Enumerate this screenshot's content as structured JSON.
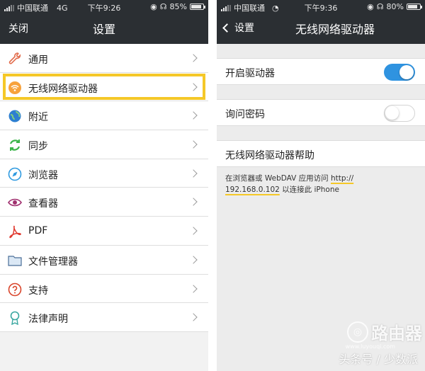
{
  "left": {
    "status": {
      "carrier": "中国联通",
      "network": "4G",
      "time": "下午9:26",
      "battery": "85%",
      "battery_level": 0.85
    },
    "nav": {
      "close": "关闭",
      "title": "设置"
    },
    "items": [
      {
        "label": "通用",
        "icon": "wrench-icon"
      },
      {
        "label": "无线网络驱动器",
        "icon": "wifi-icon"
      },
      {
        "label": "附近",
        "icon": "globe-icon"
      },
      {
        "label": "同步",
        "icon": "sync-icon"
      },
      {
        "label": "浏览器",
        "icon": "compass-icon"
      },
      {
        "label": "查看器",
        "icon": "eye-icon"
      },
      {
        "label": "PDF",
        "icon": "pdf-icon"
      },
      {
        "label": "文件管理器",
        "icon": "folder-icon"
      },
      {
        "label": "支持",
        "icon": "question-icon"
      },
      {
        "label": "法律声明",
        "icon": "ribbon-icon"
      }
    ]
  },
  "right": {
    "status": {
      "carrier": "中国联通",
      "time": "下午9:36",
      "battery": "80%",
      "battery_level": 0.8
    },
    "nav": {
      "back": "设置",
      "title": "无线网络驱动器"
    },
    "enable_driver": {
      "label": "开启驱动器",
      "on": true
    },
    "ask_password": {
      "label": "询问密码",
      "on": false
    },
    "help": {
      "label": "无线网络驱动器帮助"
    },
    "help_text": {
      "line1_pre": "在浏览器或 WebDAV 应用访问 ",
      "line1_url": "http://",
      "line2_url": "192.168.0.102",
      "line2_post": " 以连接此 iPhone"
    }
  },
  "watermark": {
    "logo_text": "路由器",
    "small": "www.luyouqi.com",
    "line": "头条号 / 少数派"
  },
  "colors": {
    "nav_bg": "#2b2f33",
    "highlight": "#f5c828",
    "toggle_on": "#2f93e0"
  }
}
